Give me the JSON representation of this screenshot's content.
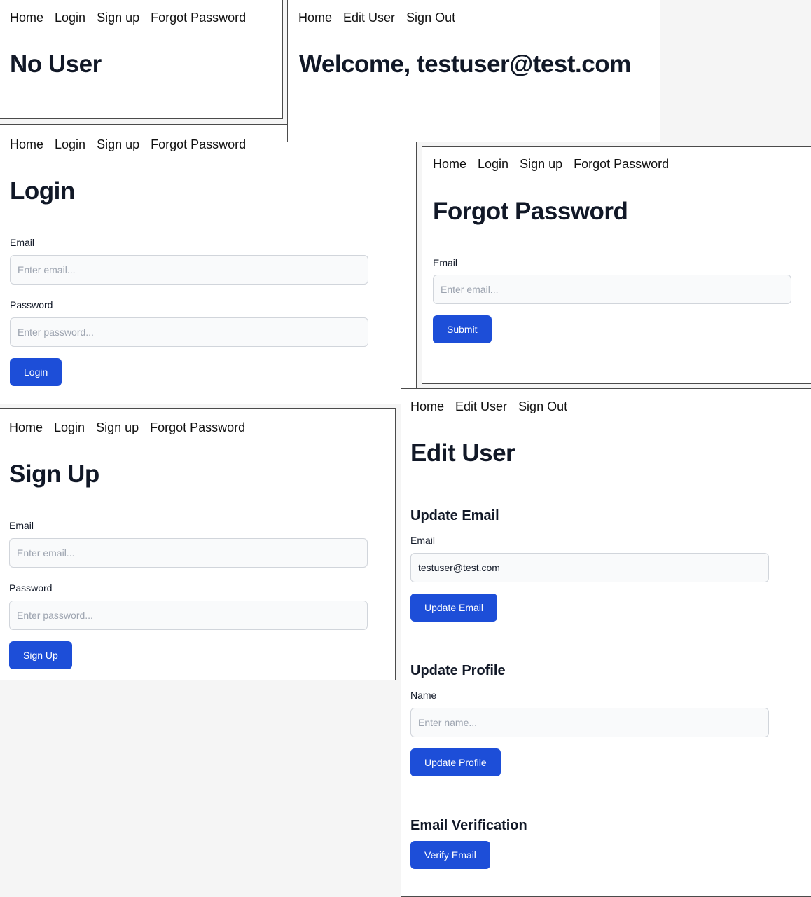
{
  "nav_guest": [
    "Home",
    "Login",
    "Sign up",
    "Forgot Password"
  ],
  "nav_user": [
    "Home",
    "Edit User",
    "Sign Out"
  ],
  "no_user": {
    "title": "No User"
  },
  "welcome": {
    "title": "Welcome, testuser@test.com"
  },
  "login": {
    "title": "Login",
    "email_label": "Email",
    "email_placeholder": "Enter email...",
    "password_label": "Password",
    "password_placeholder": "Enter password...",
    "button": "Login"
  },
  "forgot": {
    "title": "Forgot Password",
    "email_label": "Email",
    "email_placeholder": "Enter email...",
    "button": "Submit"
  },
  "signup": {
    "title": "Sign Up",
    "email_label": "Email",
    "email_placeholder": "Enter email...",
    "password_label": "Password",
    "password_placeholder": "Enter password...",
    "button": "Sign Up"
  },
  "edit": {
    "title": "Edit User",
    "update_email_heading": "Update Email",
    "email_label": "Email",
    "email_value": "testuser@test.com",
    "update_email_button": "Update Email",
    "update_profile_heading": "Update Profile",
    "name_label": "Name",
    "name_placeholder": "Enter name...",
    "update_profile_button": "Update Profile",
    "verification_heading": "Email Verification",
    "verify_button": "Verify Email"
  }
}
